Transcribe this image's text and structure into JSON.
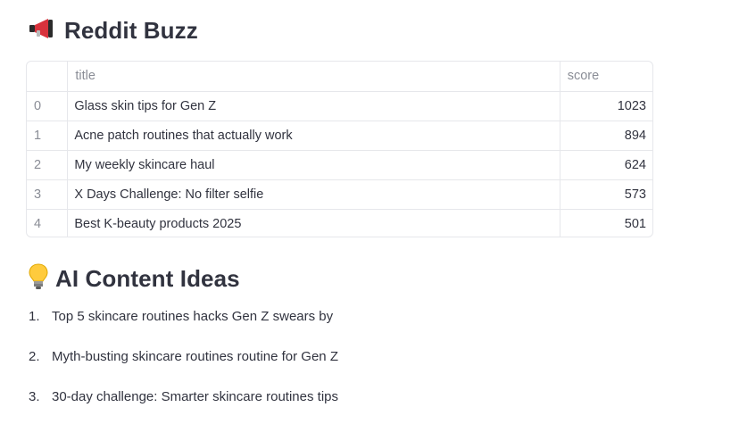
{
  "sections": {
    "reddit": {
      "icon": "megaphone-icon",
      "title": "Reddit Buzz"
    },
    "ideas": {
      "icon": "lightbulb-icon",
      "title": "AI Content Ideas"
    }
  },
  "table": {
    "columns": [
      "",
      "title",
      "score"
    ],
    "rows": [
      {
        "index": "0",
        "title": "Glass skin tips for Gen Z",
        "score": "1023"
      },
      {
        "index": "1",
        "title": "Acne patch routines that actually work",
        "score": "894"
      },
      {
        "index": "2",
        "title": "My weekly skincare haul",
        "score": "624"
      },
      {
        "index": "3",
        "title": "X Days Challenge: No filter selfie",
        "score": "573"
      },
      {
        "index": "4",
        "title": "Best K-beauty products 2025",
        "score": "501"
      }
    ]
  },
  "ideas_list": [
    {
      "num": "1.",
      "text": "Top 5 skincare routines hacks Gen Z swears by"
    },
    {
      "num": "2.",
      "text": "Myth-busting skincare routines routine for Gen Z"
    },
    {
      "num": "3.",
      "text": "30-day challenge: Smarter skincare routines tips"
    }
  ],
  "colors": {
    "text": "#31333f",
    "muted": "#8a8d96",
    "border": "#e6e7eb"
  }
}
